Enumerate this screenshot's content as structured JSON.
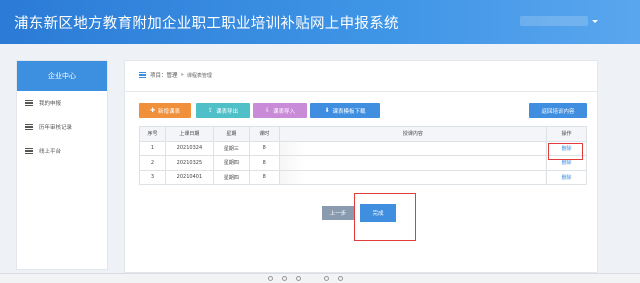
{
  "header": {
    "title": "浦东新区地方教育附加企业职工职业培训补贴网上申报系统"
  },
  "sidebar": {
    "heading": "企业中心",
    "items": [
      {
        "label": "我的申报"
      },
      {
        "label": "历年审核记录"
      },
      {
        "label": "线上平台"
      }
    ]
  },
  "breadcrumb": {
    "prefix": "项目：",
    "parent": "管理",
    "sep": "»",
    "current": "课程表管理"
  },
  "toolbar": {
    "add": "新增课表",
    "export": "课表导出",
    "import": "课表导入",
    "template": "课表模板下载",
    "back": "返回培训内容"
  },
  "table": {
    "headers": [
      "序号",
      "上课日期",
      "星期",
      "课时",
      "授课内容",
      "操作"
    ],
    "rows": [
      {
        "no": "1",
        "date": "20210324",
        "weekday": "星期三",
        "hours": "8",
        "content": "",
        "op": "删除"
      },
      {
        "no": "2",
        "date": "20210325",
        "weekday": "星期四",
        "hours": "8",
        "content": "",
        "op": "删除"
      },
      {
        "no": "3",
        "date": "20210401",
        "weekday": "星期四",
        "hours": "8",
        "content": "",
        "op": "删除"
      }
    ]
  },
  "footer_buttons": {
    "prev": "上一步",
    "done": "完成"
  },
  "colors": {
    "header": "#2b7bd6",
    "accent": "#3f8ee0",
    "highlight": "#e23c3c",
    "add": "#f0903a",
    "export": "#4fc0c8",
    "import": "#c98bd8"
  }
}
